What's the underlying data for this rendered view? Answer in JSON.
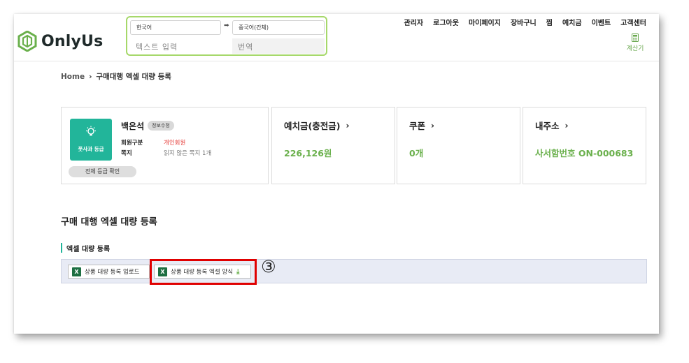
{
  "brand": {
    "name": "OnlyUs",
    "accent": "#6ab04c",
    "teal": "#22b59a"
  },
  "translator": {
    "source_lang": "한국어",
    "target_lang": "중국어(간체)",
    "swap_icon": "arrow-right-icon",
    "input_placeholder": "텍스트 입력",
    "output_placeholder": "번역"
  },
  "topnav": [
    "관리자",
    "로그아웃",
    "마이페이지",
    "장바구니",
    "찜",
    "예치금",
    "이벤트",
    "고객센터"
  ],
  "calculator": {
    "label": "계산기",
    "icon": "calculator-icon"
  },
  "breadcrumb": {
    "home": "Home",
    "separator": "›",
    "current": "구매대행 엑셀 대량 등록"
  },
  "profile": {
    "grade_label": "풋사과 등급",
    "grade_icon": "lightbulb-icon",
    "name": "백은석",
    "edit_label": "정보수정",
    "member_type_label": "회원구분",
    "member_type_value": "개인회원",
    "message_label": "쪽지",
    "message_value": "읽지 않은 쪽지 1개",
    "all_grades_button": "전체 등급 확인"
  },
  "cards": {
    "deposit": {
      "title": "예치금(충전금)",
      "value": "226,126원"
    },
    "coupon": {
      "title": "쿠폰",
      "value": "0개"
    },
    "address": {
      "title": "내주소",
      "value": "사서함번호 ON-000683"
    },
    "chevron": "›"
  },
  "section": {
    "title": "구매 대행 엑셀 대량 등록",
    "subtitle": "엑셀 대량 등록",
    "upload_button": "상품 대량 등록 업로드",
    "template_button": "상품 대량 등록 엑셀 양식",
    "excel_icon_letter": "X",
    "download_icon": "⤓"
  },
  "annotation": {
    "step": "③",
    "highlight_color": "#e00000"
  }
}
